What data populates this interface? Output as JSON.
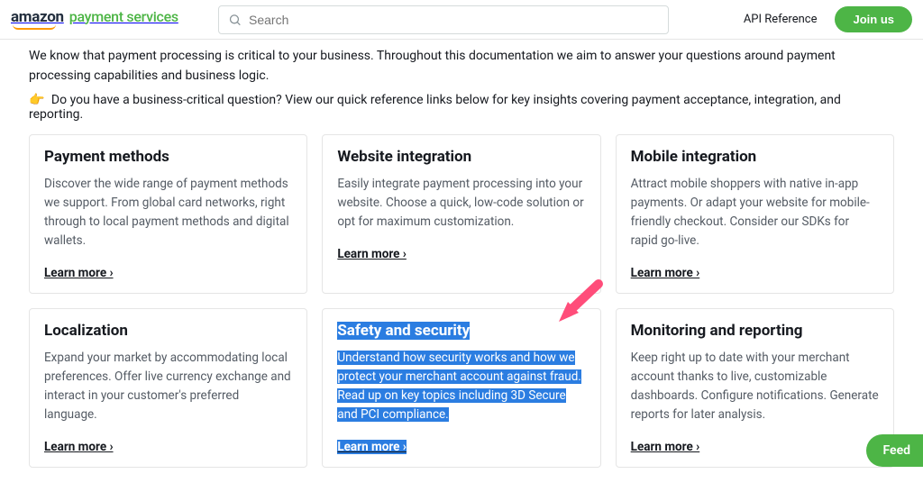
{
  "header": {
    "logo_amazon": "amazon",
    "logo_ps": "payment services",
    "search_placeholder": "Search",
    "api_reference": "API Reference",
    "join_us": "Join us"
  },
  "intro": "We know that payment processing is critical to your business. Throughout this documentation we aim to answer your questions around payment processing capabilities and business logic.",
  "callout": "Do you have a business-critical question? View our quick reference links below for key insights covering payment acceptance, integration, and reporting.",
  "learn_more": "Learn more ›",
  "cards": [
    {
      "title": "Payment methods",
      "desc": "Discover the wide range of payment methods we support. From global card networks, right through to local payment methods and digital wallets."
    },
    {
      "title": "Website integration",
      "desc": "Easily integrate payment processing into your website. Choose a quick, low-code solution or opt for maximum customization."
    },
    {
      "title": "Mobile integration",
      "desc": "Attract mobile shoppers with native in-app payments. Or adapt your website for mobile-friendly checkout. Consider our SDKs for rapid go-live."
    },
    {
      "title": "Localization",
      "desc": "Expand your market by accommodating local preferences. Offer live currency exchange and interact in your customer's preferred language."
    },
    {
      "title": "Safety and security",
      "desc": "Understand how security works and how we protect your merchant account against fraud. Read up on key topics including 3D Secure and PCI compliance."
    },
    {
      "title": "Monitoring and reporting",
      "desc": "Keep right up to date with your merchant account thanks to live, customizable dashboards. Configure notifications. Generate reports for later analysis."
    }
  ],
  "feedback": "Feed"
}
